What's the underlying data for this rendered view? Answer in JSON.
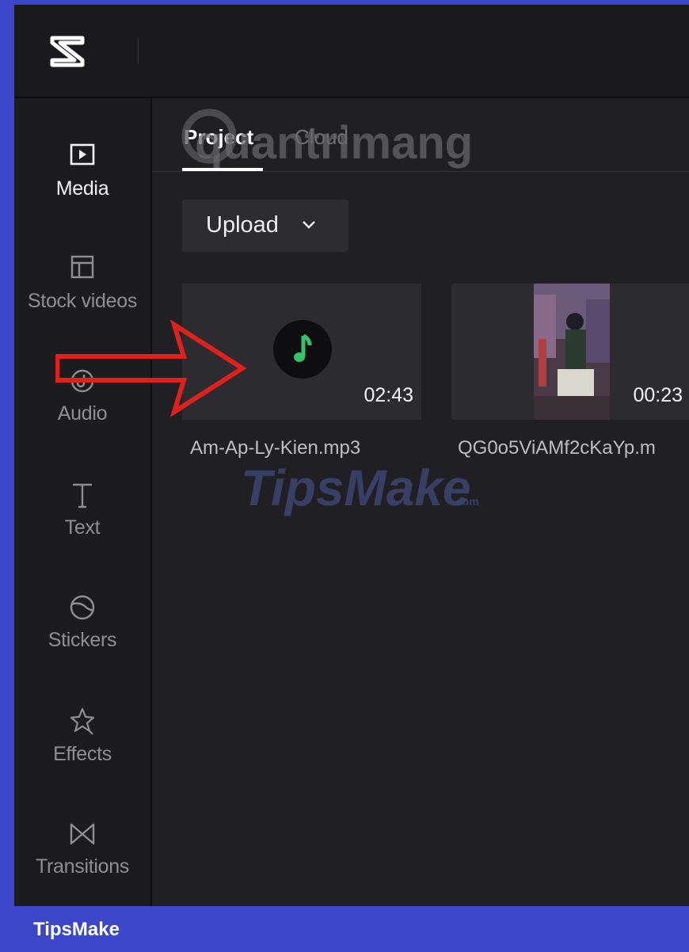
{
  "app": {
    "logo_icon": "capcut-logo-icon"
  },
  "sidebar": {
    "items": [
      {
        "label": "Media",
        "icon": "media-icon",
        "active": true
      },
      {
        "label": "Stock videos",
        "icon": "stock-videos-icon",
        "active": false
      },
      {
        "label": "Audio",
        "icon": "audio-icon",
        "active": false
      },
      {
        "label": "Text",
        "icon": "text-icon",
        "active": false
      },
      {
        "label": "Stickers",
        "icon": "stickers-icon",
        "active": false
      },
      {
        "label": "Effects",
        "icon": "effects-icon",
        "active": false
      },
      {
        "label": "Transitions",
        "icon": "transitions-icon",
        "active": false
      }
    ]
  },
  "main": {
    "tabs": [
      {
        "label": "Project",
        "active": true
      },
      {
        "label": "Cloud",
        "active": false
      }
    ],
    "upload_label": "Upload",
    "media": [
      {
        "name": "Am-Ap-Ly-Kien.mp3",
        "duration": "02:43",
        "kind": "audio",
        "icon": "music-note-icon"
      },
      {
        "name": "QG0o5ViAMf2cKaYp.m",
        "duration": "00:23",
        "kind": "video"
      }
    ]
  },
  "overlay": {
    "watermark_top": "quantrimang",
    "watermark_mid": "TipsMake",
    "watermark_mid_suffix": ".com",
    "annotation": "red-arrow-pointer"
  },
  "footer": {
    "label": "TipsMake"
  },
  "colors": {
    "frame": "#3b47c8",
    "accent_music": "#35c26b",
    "annotation_arrow": "#e0201b"
  }
}
